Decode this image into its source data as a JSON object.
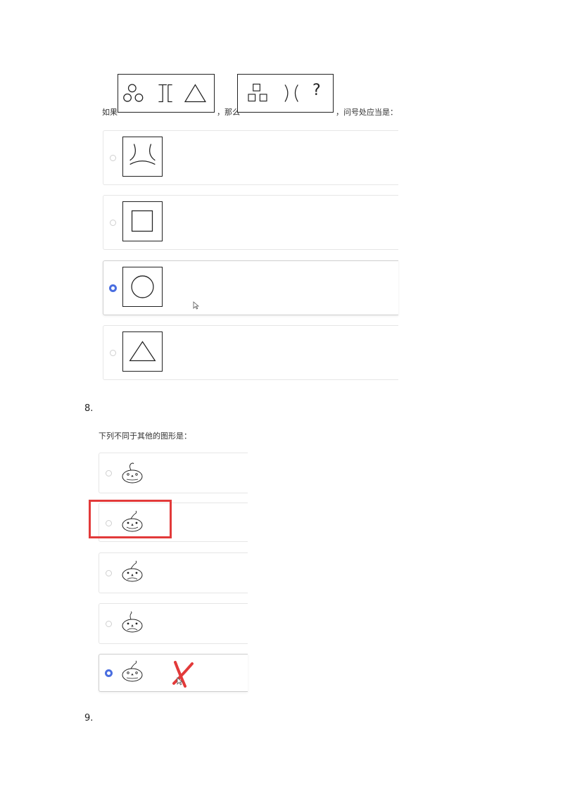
{
  "q7": {
    "prefix": "如果",
    "middle": "，那么",
    "suffix": "，问号处应当是：",
    "question_mark": "?",
    "options": [
      {
        "figure": "curved-triangle",
        "selected": false
      },
      {
        "figure": "square-in-square",
        "selected": false
      },
      {
        "figure": "circle-in-square",
        "selected": true
      },
      {
        "figure": "triangle-in-square",
        "selected": false
      }
    ]
  },
  "q8": {
    "number": "8.",
    "prompt": "下列不同于其他的图形是：",
    "options": [
      {
        "figure": "pumpkin-face",
        "selected": false
      },
      {
        "figure": "pumpkin-face",
        "selected": false,
        "highlighted": true
      },
      {
        "figure": "pumpkin-face",
        "selected": false
      },
      {
        "figure": "pumpkin-face",
        "selected": false
      },
      {
        "figure": "pumpkin-face",
        "selected": true,
        "marked_wrong": true
      }
    ]
  },
  "q9": {
    "number": "9."
  },
  "colors": {
    "radio_checked": "#4a6ee0",
    "highlight_red": "#e23a3a"
  }
}
